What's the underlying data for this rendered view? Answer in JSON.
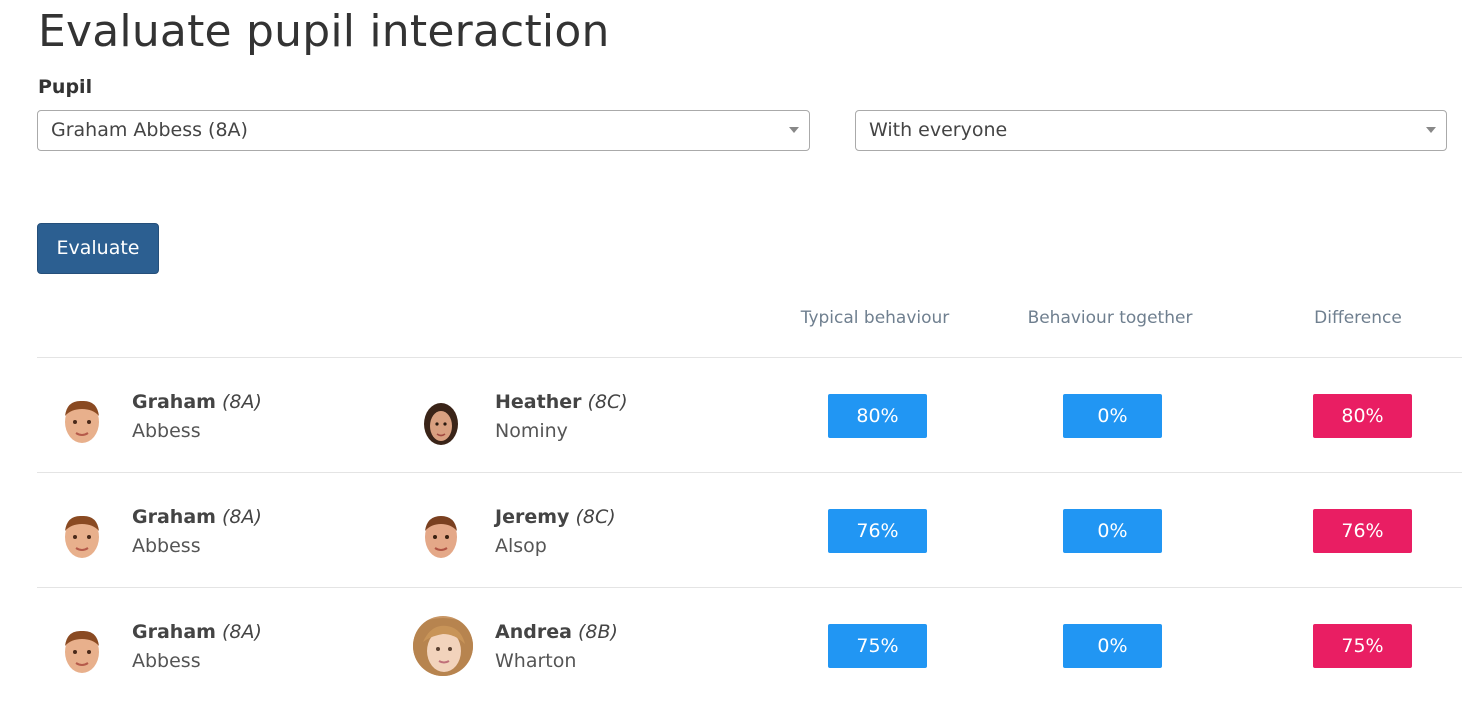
{
  "page": {
    "title": "Evaluate pupil interaction"
  },
  "form": {
    "pupil_label": "Pupil",
    "pupil_selected": "Graham Abbess (8A)",
    "scope_selected": "With everyone",
    "evaluate_label": "Evaluate"
  },
  "table": {
    "headers": {
      "typical": "Typical behaviour",
      "together": "Behaviour together",
      "difference": "Difference"
    },
    "rows": [
      {
        "pupil1": {
          "first": "Graham",
          "class": "(8A)",
          "last": "Abbess"
        },
        "pupil2": {
          "first": "Heather",
          "class": "(8C)",
          "last": "Nominy"
        },
        "typical": "80%",
        "together": "0%",
        "difference": "80%"
      },
      {
        "pupil1": {
          "first": "Graham",
          "class": "(8A)",
          "last": "Abbess"
        },
        "pupil2": {
          "first": "Jeremy",
          "class": "(8C)",
          "last": "Alsop"
        },
        "typical": "76%",
        "together": "0%",
        "difference": "76%"
      },
      {
        "pupil1": {
          "first": "Graham",
          "class": "(8A)",
          "last": "Abbess"
        },
        "pupil2": {
          "first": "Andrea",
          "class": "(8B)",
          "last": "Wharton"
        },
        "typical": "75%",
        "together": "0%",
        "difference": "75%"
      }
    ]
  },
  "colors": {
    "primary_button": "#2c5f91",
    "badge_blue": "#2196f3",
    "badge_pink": "#e91e63"
  },
  "icons": {
    "dropdown": "chevron-down-icon",
    "avatar": "pupil-avatar"
  }
}
